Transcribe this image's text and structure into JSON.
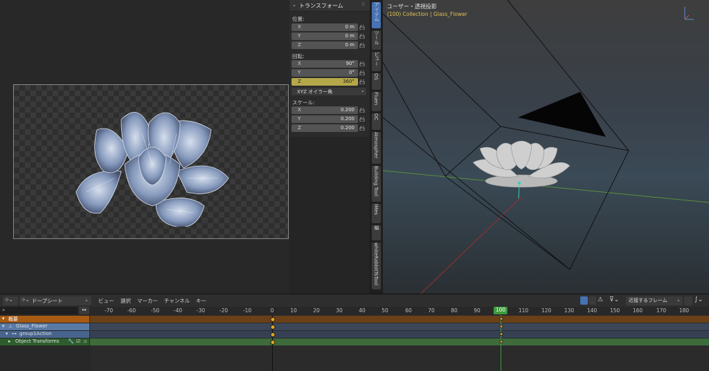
{
  "npanel": {
    "title": "トランスフォーム",
    "location": {
      "label": "位置:",
      "x_label": "X",
      "x": "0 m",
      "y_label": "Y",
      "y": "0 m",
      "z_label": "Z",
      "z": "0 m"
    },
    "rotation": {
      "label": "回転:",
      "x_label": "X",
      "x": "90°",
      "y_label": "Y",
      "y": "0°",
      "z_label": "Z",
      "z": "360°"
    },
    "rotation_mode": "XYZ オイラー角",
    "scale": {
      "label": "スケール:",
      "x_label": "X",
      "x": "0.200",
      "y_label": "Y",
      "y": "0.200",
      "z_label": "Z",
      "z": "0.200"
    }
  },
  "tabs": [
    "アイテム",
    "ツール",
    "ビュー",
    "OS",
    "Fluen",
    "OC",
    "Atmospher",
    "Building Tool",
    "IMes",
    "編",
    "whiteRabbitTsTool"
  ],
  "viewport": {
    "title": "ユーザー・透視投影",
    "subtitle": "(100) Collection | Glass_Flower"
  },
  "timeline": {
    "editor_type": "ドープシート",
    "menus": [
      "ビュー",
      "選択",
      "マーカー",
      "チャンネル",
      "キー"
    ],
    "snap_mode": "近接するフレーム",
    "ruler": [
      "-70",
      "-60",
      "-50",
      "-40",
      "-30",
      "-20",
      "-10",
      "0",
      "10",
      "20",
      "30",
      "40",
      "50",
      "60",
      "70",
      "80",
      "90",
      "100",
      "110",
      "120",
      "130",
      "140",
      "150",
      "160",
      "170",
      "180"
    ],
    "current_frame": "100",
    "channels": {
      "summary": "概要",
      "object": "Glass_Flower",
      "action": "group1Action",
      "group": "Object Transforms"
    },
    "keyframes": [
      0,
      100
    ]
  },
  "colors": {
    "accent": "#4772b3",
    "current_frame": "#3d9b3d",
    "keyframe": "#e0a820",
    "summary_row": "#a65a12",
    "highlight_field": "#b5a84a"
  }
}
